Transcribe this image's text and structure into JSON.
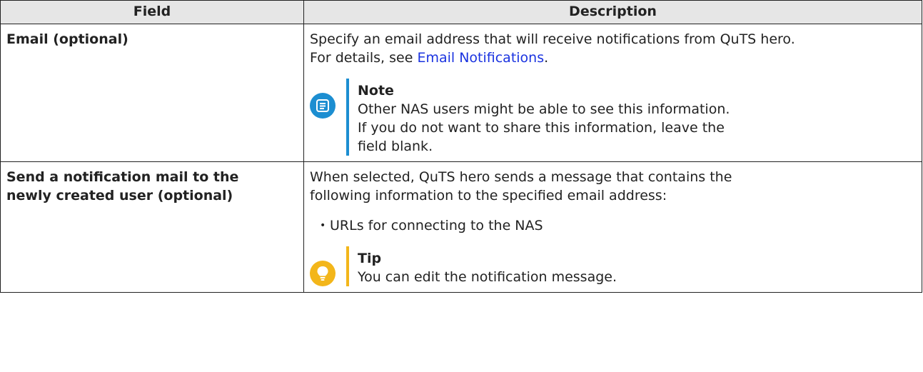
{
  "table": {
    "headers": {
      "field": "Field",
      "description": "Description"
    },
    "rows": [
      {
        "field": "Email (optional)",
        "desc_text": "Specify an email address that will receive notifications from QuTS hero.",
        "desc_details_prefix": "For details, see ",
        "desc_link": "Email Notifications",
        "desc_details_suffix": ".",
        "note": {
          "title": "Note",
          "line1": "Other NAS users might be able to see this information.",
          "line2": "If you do not want to share this information, leave the",
          "line3": "field blank.",
          "icon": "note-icon"
        }
      },
      {
        "field_line1": "Send a notification mail to the",
        "field_line2": "newly created user (optional)",
        "desc_line1": "When selected, QuTS hero sends a message that contains the",
        "desc_line2": "following information to the specified email address:",
        "bullets": [
          "URLs for connecting to the NAS"
        ],
        "tip": {
          "title": "Tip",
          "text": "You can edit the notification message.",
          "icon": "lightbulb-icon"
        }
      }
    ]
  },
  "colors": {
    "link": "#1a33e0",
    "note_accent": "#1c8ed1",
    "tip_accent": "#f3b61a",
    "header_bg": "#e6e6e6"
  }
}
